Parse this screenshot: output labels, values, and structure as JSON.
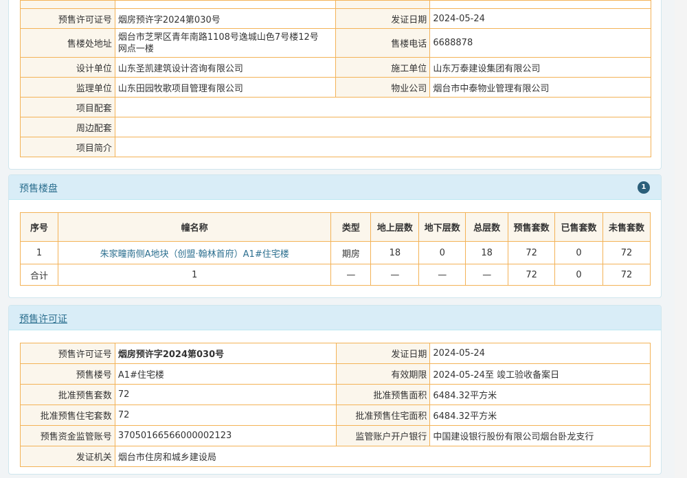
{
  "project_info": {
    "rows": [
      {
        "l1": "",
        "v1": "",
        "l2": "",
        "v2": ""
      },
      {
        "l1": "预售许可证号",
        "v1": "烟房预许字2024第030号",
        "l2": "发证日期",
        "v2": "2024-05-24"
      },
      {
        "l1": "售楼处地址",
        "v1a": "烟台市芝罘区青年南路1108号逸城山色7号楼12号",
        "v1b": "网点一楼",
        "l2": "售楼电话",
        "v2": "6688878"
      },
      {
        "l1": "设计单位",
        "v1": "山东圣凯建筑设计咨询有限公司",
        "l2": "施工单位",
        "v2": "山东万泰建设集团有限公司"
      },
      {
        "l1": "监理单位",
        "v1": "山东田园牧歌项目管理有限公司",
        "l2": "物业公司",
        "v2": "烟台市中泰物业管理有限公司"
      },
      {
        "l1": "项目配套",
        "v1": ""
      },
      {
        "l1": "周边配套",
        "v1": ""
      },
      {
        "l1": "项目简介",
        "v1": ""
      }
    ]
  },
  "presale_buildings": {
    "title": "预售楼盘",
    "badge": "1",
    "headers": [
      "序号",
      "幢名称",
      "类型",
      "地上层数",
      "地下层数",
      "总层数",
      "预售套数",
      "已售套数",
      "未售套数"
    ],
    "rows": [
      [
        "1",
        "朱家疃南侧A地块（创盟·翰林首府）A1#住宅楼",
        "期房",
        "18",
        "0",
        "18",
        "72",
        "0",
        "72"
      ]
    ],
    "total": [
      "合计",
      "1",
      "—",
      "—",
      "—",
      "—",
      "72",
      "0",
      "72"
    ]
  },
  "presale_permit": {
    "title": "预售许可证",
    "rows": [
      {
        "l1": "预售许可证号",
        "v1": "烟房预许字2024第030号",
        "l2": "发证日期",
        "v2": "2024-05-24"
      },
      {
        "l1": "预售楼号",
        "v1": "A1#住宅楼",
        "l2": "有效期限",
        "v2": "2024-05-24至 竣工验收备案日"
      },
      {
        "l1": "批准预售套数",
        "v1": "72",
        "l2": "批准预售面积",
        "v2": "6484.32平方米"
      },
      {
        "l1": "批准预售住宅套数",
        "v1": "72",
        "l2": "批准预售住宅面积",
        "v2": "6484.32平方米"
      },
      {
        "l1": "预售资金监管账号",
        "v1": "37050166566000002123",
        "l2": "监管账户开户银行",
        "v2": "中国建设银行股份有限公司烟台卧龙支行"
      },
      {
        "l1": "发证机关",
        "v1": "烟台市住房和城乡建设局"
      }
    ]
  }
}
